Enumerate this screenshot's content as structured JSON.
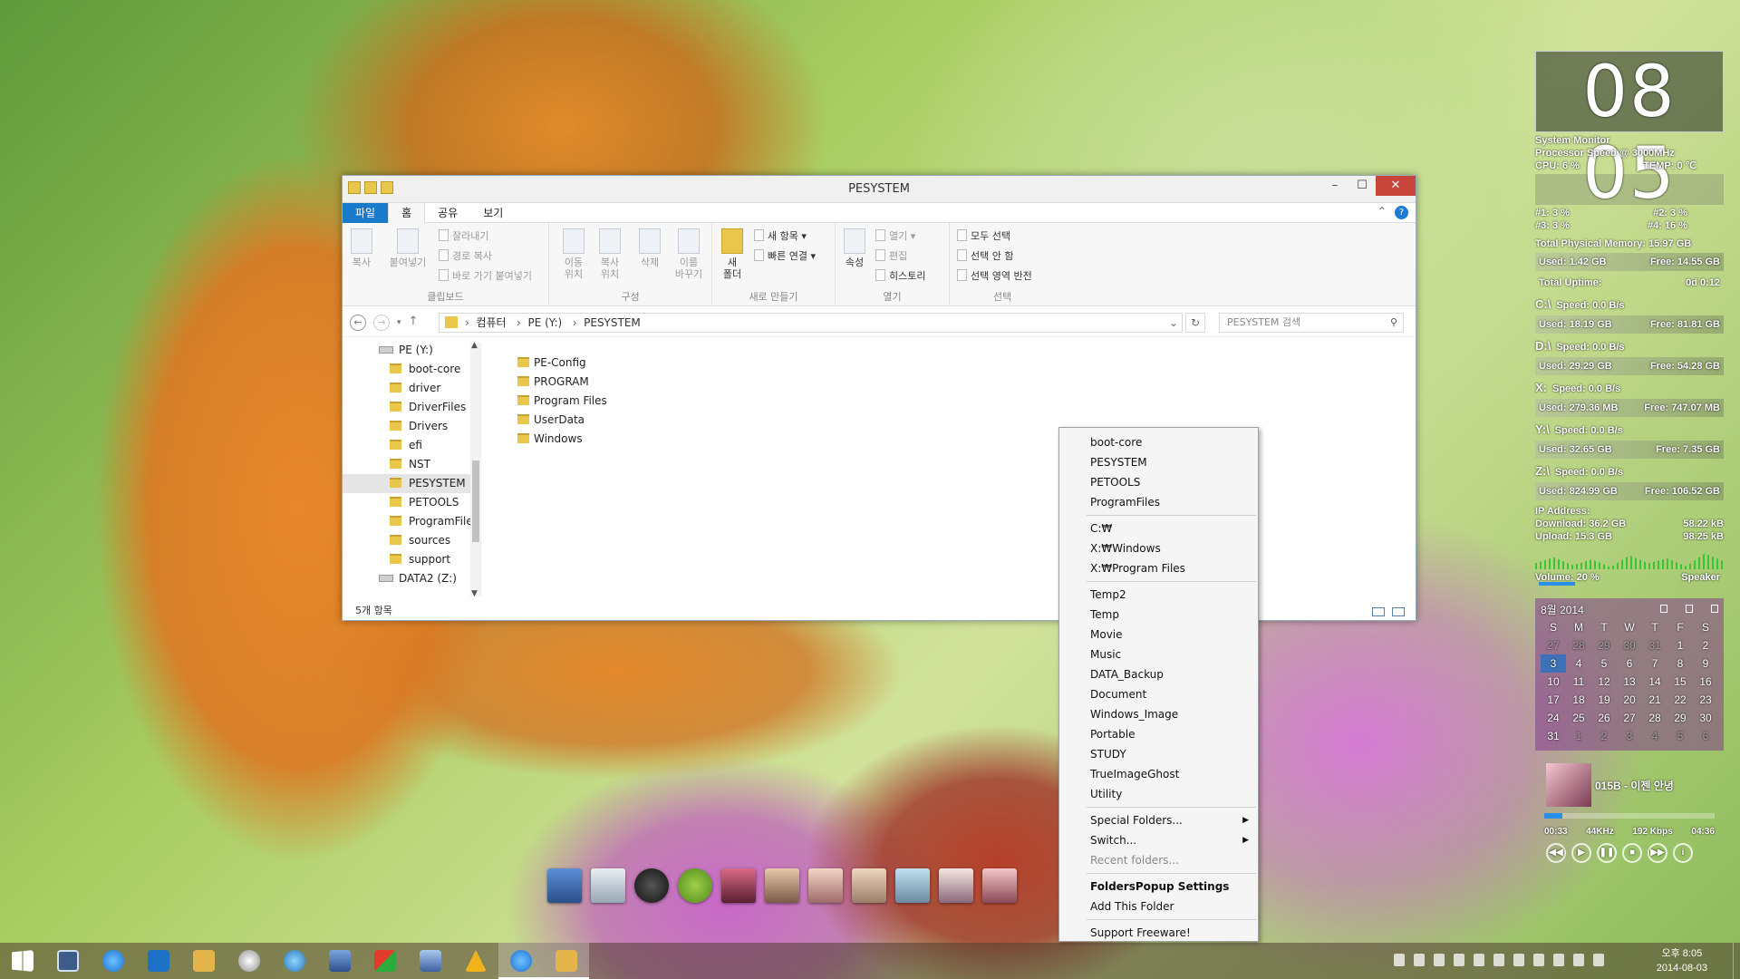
{
  "window": {
    "title": "PESYSTEM",
    "tabs": [
      "파일",
      "홈",
      "공유",
      "보기"
    ],
    "help": "?",
    "ribbon": {
      "clipboard": {
        "label": "클립보드",
        "copy": "복사",
        "paste": "붙여넣기",
        "cut": "잘라내기",
        "copy_path": "경로 복사",
        "paste_shortcut": "바로 가기 붙여넣기"
      },
      "organize": {
        "label": "구성",
        "move_to": "이동\n위치",
        "copy_to": "복사\n위치",
        "delete": "삭제",
        "rename": "이름\n바꾸기"
      },
      "new": {
        "label": "새로 만들기",
        "new_folder": "새\n폴더",
        "new_item": "새 항목 ▾",
        "easy_access": "빠른 연결 ▾"
      },
      "open": {
        "label": "열기",
        "properties": "속성",
        "open": "열기 ▾",
        "edit": "편집",
        "history": "히스토리"
      },
      "select": {
        "label": "선택",
        "select_all": "모두 선택",
        "select_none": "선택 안 함",
        "invert": "선택 영역 반전"
      }
    },
    "address": {
      "crumbs": [
        "컴퓨터",
        "PE (Y:)",
        "PESYSTEM"
      ],
      "search_placeholder": "PESYSTEM 검색"
    },
    "tree": [
      {
        "label": "PE (Y:)",
        "type": "drive"
      },
      {
        "label": "boot-core",
        "type": "folder"
      },
      {
        "label": "driver",
        "type": "folder"
      },
      {
        "label": "DriverFiles",
        "type": "folder"
      },
      {
        "label": "Drivers",
        "type": "folder"
      },
      {
        "label": "efi",
        "type": "folder"
      },
      {
        "label": "NST",
        "type": "folder"
      },
      {
        "label": "PESYSTEM",
        "type": "folder",
        "selected": true
      },
      {
        "label": "PETOOLS",
        "type": "folder"
      },
      {
        "label": "ProgramFiles",
        "type": "folder"
      },
      {
        "label": "sources",
        "type": "folder"
      },
      {
        "label": "support",
        "type": "folder"
      },
      {
        "label": "DATA2 (Z:)",
        "type": "drive"
      }
    ],
    "files": [
      "PE-Config",
      "PROGRAM",
      "Program Files",
      "UserData",
      "Windows"
    ],
    "status": "5개 항목"
  },
  "context_menu": {
    "groups": [
      [
        "boot-core",
        "PESYSTEM",
        "PETOOLS",
        "ProgramFiles"
      ],
      [
        "C:₩",
        "X:₩Windows",
        "X:₩Program Files"
      ],
      [
        "Temp2",
        "Temp",
        "Movie",
        "Music",
        "DATA_Backup",
        "Document",
        "Windows_Image",
        "Portable",
        "STUDY",
        "TrueImageGhost",
        "Utility"
      ]
    ],
    "special_folders": "Special Folders...",
    "switch": "Switch...",
    "recent": "Recent folders...",
    "settings": "FoldersPopup Settings",
    "add_folder": "Add This Folder",
    "support": "Support Freeware!"
  },
  "sidebar": {
    "clock": "08 05",
    "sysmon": {
      "title": "System Monitor",
      "speed": "Processor Speed @ 3000MHz",
      "cpu": "CPU:   6 %",
      "temp": "TEMP: 0 ℃",
      "core1": "#1:  3 %",
      "core2": "#2:  3 %",
      "core3": "#3:  3 %",
      "core4": "#4:   16 %",
      "mem_total": "Total Physical Memory: 15.97 GB",
      "mem_used": "Used:  1.42 GB",
      "mem_free": "Free: 14.55 GB",
      "uptime_label": "Total Uptime:",
      "uptime": "0d 0:12"
    },
    "drives": [
      {
        "name": "C:\\",
        "speed": "Speed: 0.0 B/s",
        "used": "Used:   18.19 GB",
        "free": "Free:  81.81 GB"
      },
      {
        "name": "D:\\",
        "speed": "Speed: 0.0 B/s",
        "used": "Used:   29.29 GB",
        "free": "Free:  54.28 GB"
      },
      {
        "name": "X:",
        "speed": "Speed: 0.0 B/s",
        "used": "Used:   279.36 MB",
        "free": "Free:  747.07 MB"
      },
      {
        "name": "Y:\\",
        "speed": "Speed: 0.0 B/s",
        "used": "Used:   32.65 GB",
        "free": "Free:   7.35 GB"
      },
      {
        "name": "Z:\\",
        "speed": "Speed: 0.0 B/s",
        "used": "Used:   824.99 GB",
        "free": "Free:  106.52 GB"
      }
    ],
    "network": {
      "ip": "IP Address:",
      "download": "Download:  36.2 GB",
      "download_rate": "58.22 kB",
      "upload": "Upload:  15.3 GB",
      "upload_rate": "98.25 kB"
    },
    "volume": {
      "label": "Volume:  20 %",
      "device": "Speaker",
      "level": 0.2
    },
    "calendar": {
      "month": "8월 2014",
      "days": [
        "S",
        "M",
        "T",
        "W",
        "T",
        "F",
        "S"
      ],
      "weeks": [
        [
          "27",
          "28",
          "29",
          "30",
          "31",
          "1",
          "2"
        ],
        [
          "3",
          "4",
          "5",
          "6",
          "7",
          "8",
          "9"
        ],
        [
          "10",
          "11",
          "12",
          "13",
          "14",
          "15",
          "16"
        ],
        [
          "17",
          "18",
          "19",
          "20",
          "21",
          "22",
          "23"
        ],
        [
          "24",
          "25",
          "26",
          "27",
          "28",
          "29",
          "30"
        ],
        [
          "31",
          "1",
          "2",
          "3",
          "4",
          "5",
          "6"
        ]
      ],
      "today": "3"
    },
    "player": {
      "track": "015B - 이젠 안녕",
      "elapsed": "00:33",
      "rate": "44KHz",
      "bitrate": "192 Kbps",
      "length": "04:36"
    }
  },
  "taskbar": {
    "time": "오후 8:05",
    "date": "2014-08-03"
  }
}
